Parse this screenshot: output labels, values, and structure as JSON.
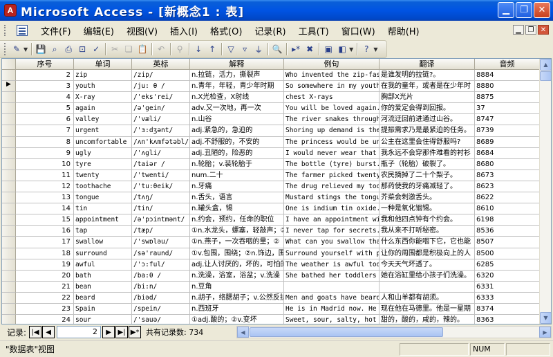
{
  "window": {
    "title": "Microsoft Access - [新概念1 : 表]",
    "app_icon": "A"
  },
  "menu": [
    "文件(F)",
    "编辑(E)",
    "视图(V)",
    "插入(I)",
    "格式(O)",
    "记录(R)",
    "工具(T)",
    "窗口(W)",
    "帮助(H)"
  ],
  "columns": [
    "序号",
    "单词",
    "英标",
    "解释",
    "例句",
    "翻译",
    "音频"
  ],
  "rows": [
    [
      "2",
      "zip",
      "/zip/",
      "n.拉链，活力，撕裂声",
      "Who invented the zip-fast",
      "是谁发明的拉链?。",
      "8884"
    ],
    [
      "3",
      "youth",
      "/ju: θ /",
      "n.青年，年轻，青少年时期",
      "So somewhere in my youth",
      "在我的童年，或者是在少年时",
      "8880"
    ],
    [
      "4",
      "X-ray",
      "/'eks'rei/",
      "n.X光检查，X射线",
      "chest X-rays",
      "胸部X光片",
      "8875"
    ],
    [
      "5",
      "again",
      "/ə'gein/",
      "adv.又一次地，再一次",
      "You will be loved again.",
      "你的爱定会得到回报。",
      "37"
    ],
    [
      "6",
      "valley",
      "/'væli/",
      "n.山谷",
      "The river snakes through",
      "河流迂回前进通过山谷。",
      "8747"
    ],
    [
      "7",
      "urgent",
      "/'ɜ:dʒənt/",
      "adj.紧急的，急迫的",
      "Shoring up demand is the",
      "提振需求乃是最紧迫的任务。",
      "8739"
    ],
    [
      "8",
      "uncomfortable",
      "/ʌn'kʌmfətəbl/",
      "adj.不舒服的，不安的",
      "The princess would be unc",
      "公主在这里会住得舒服吗?",
      "8689"
    ],
    [
      "9",
      "ugly",
      "/'ʌgli/",
      "adj.丑陋的，险恶的",
      "I would never wear that u",
      "我永远不会穿那件难看的衬衫",
      "8684"
    ],
    [
      "10",
      "tyre",
      "/taiər /",
      "n.轮胎；v.装轮胎于",
      "The bottle (tyre) burst.",
      "瓶子（轮胎）破裂了。",
      "8680"
    ],
    [
      "11",
      "twenty",
      "/'twenti/",
      "num.二十",
      "The farmer picked twenty",
      "农民摘掉了二十个梨子。",
      "8673"
    ],
    [
      "12",
      "toothache",
      "/'tu:θeik/",
      "n.牙痛",
      "The drug relieved my toot",
      "那药使我的牙痛减轻了。",
      "8623"
    ],
    [
      "13",
      "tongue",
      "/tʌŋ/",
      "n.舌头，语言",
      "Mustard stings the tongue",
      "芥菜会刺激舌头。",
      "8622"
    ],
    [
      "14",
      "tin",
      "/tin/",
      "n.罐头盒，锡",
      "One is indium tin oxide.",
      "一种是氧化铟锡。",
      "8610"
    ],
    [
      "15",
      "appointment",
      "/ə'pɔintmənt/",
      "n.约会，预约，任命的职位",
      "I have an appointment wit",
      "我和他四点钟有个约会。",
      "6198"
    ],
    [
      "16",
      "tap",
      "/tæp/",
      "①n.水龙头，螺塞，轻敲声；②",
      "I never tap for secrets.",
      "我从来不打听秘密。",
      "8536"
    ],
    [
      "17",
      "swallow",
      "/'swɒləu/",
      "①n.燕子，一次吞咽的量；②",
      "What can you swallow that",
      "什么东西你能咽下它，它也能",
      "8507"
    ],
    [
      "18",
      "surround",
      "/sə'raund/",
      "①v.包围，围绕；②n.饰边，围",
      "Surround yourself with po",
      "让你的周围都是积极向上的人",
      "8500"
    ],
    [
      "19",
      "awful",
      "/'ɔ:ful/",
      "adj.让人讨厌的，坏的，可怕的",
      "The weather is awful toda",
      "今天天气坏透了。",
      "6285"
    ],
    [
      "20",
      "bath",
      "/ba:θ /",
      "n.洗澡，浴室，浴盆；v.洗澡",
      "She bathed her toddlers i",
      "她在浴缸里给小孩子们洗澡。",
      "6320"
    ],
    [
      "21",
      "bean",
      "/bi:n/",
      "n.豆角",
      "",
      "",
      "6331"
    ],
    [
      "22",
      "beard",
      "/biəd/",
      "n.胡子，络腮胡子；v.公然反抗",
      "Men and goats have beards",
      "人和山羊都有胡须。",
      "6333"
    ],
    [
      "23",
      "Spain",
      "/spein/",
      "n.西班牙",
      "He is in Madrid now. He",
      "现在他在马德里。他是一星期",
      "8374"
    ],
    [
      "24",
      "sour",
      "/'sauə/",
      "①adj.酸的；②v.变坏",
      "Sweet, sour, salty, hot",
      "甜的，酸的，咸的，辣的。",
      "8363"
    ],
    [
      "25",
      "soap",
      "/səup/",
      "n.肥皂",
      "We need a towel , a brush",
      "我们还要一条毛巾，一个刷子",
      "8345"
    ],
    [
      "26",
      "bone",
      "/bəun/",
      "n.骨头，骨质物（复数bones）",
      "The dog was chewing a bon",
      "狗在啃一根骨头。",
      "6363"
    ],
    [
      "27",
      "bookcase",
      "/'bukkeis/",
      "n.书橱，书架",
      "The bookcase contains fif",
      "这书橱装有50册书，但它能装",
      "6395"
    ]
  ],
  "navigator": {
    "label": "记录:",
    "current": "2",
    "total": "共有记录数: 734"
  },
  "status": {
    "view": "\"数据表\"视图",
    "num": "NUM"
  }
}
